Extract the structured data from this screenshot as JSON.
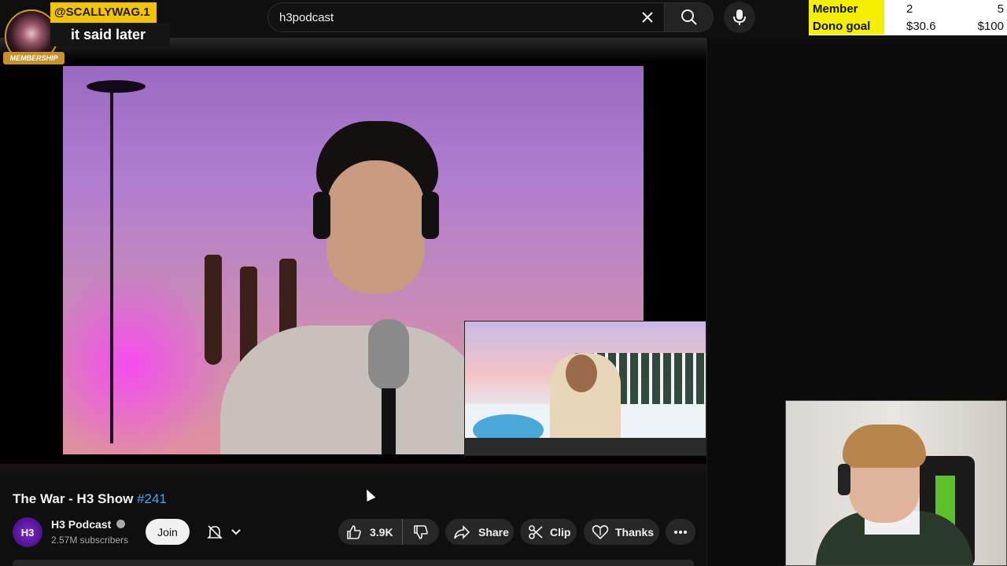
{
  "search": {
    "value": "h3podcast"
  },
  "chat": {
    "user": "@SCALLYWAG.1",
    "message": "it said later",
    "badge": "MEMBERSHIP"
  },
  "goals": [
    {
      "label": "Member Goal",
      "current": "2",
      "target": "5"
    },
    {
      "label": "Dono goal",
      "current": "$30.6",
      "target": "$100"
    }
  ],
  "video": {
    "title": "The War - H3 Show",
    "tag": "#241"
  },
  "channel": {
    "avatar_text": "H3",
    "name": "H3 Podcast",
    "subscribers": "2.57M subscribers",
    "join_label": "Join"
  },
  "actions": {
    "likes": "3.9K",
    "share": "Share",
    "clip": "Clip",
    "thanks": "Thanks"
  },
  "colors": {
    "accent_link": "#3ea6ff",
    "goal_highlight": "#f5f000",
    "chat_user_bg": "#f2c400"
  }
}
